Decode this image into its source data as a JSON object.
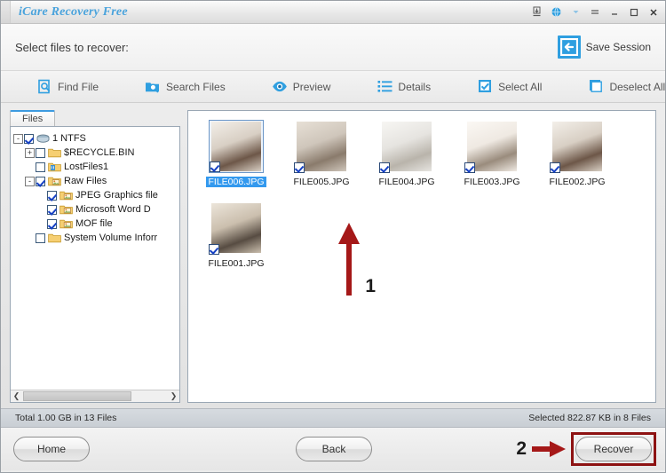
{
  "window": {
    "title": "iCare Recovery Free",
    "controls": [
      {
        "name": "save-download-icon",
        "glyph": "download"
      },
      {
        "name": "globe-icon",
        "glyph": "globe"
      },
      {
        "name": "dropdown-caret-icon",
        "glyph": "caret"
      },
      {
        "name": "menu-icon",
        "glyph": "menu"
      },
      {
        "name": "minimize-button",
        "glyph": "minimize"
      },
      {
        "name": "maximize-button",
        "glyph": "maximize"
      },
      {
        "name": "close-button",
        "glyph": "close"
      }
    ]
  },
  "header": {
    "title": "Select files to recover:",
    "save_session_label": "Save Session"
  },
  "toolbar": {
    "items": [
      {
        "label": "Find File",
        "icon": "find-file-icon"
      },
      {
        "label": "Search Files",
        "icon": "search-files-icon"
      },
      {
        "label": "Preview",
        "icon": "preview-eye-icon"
      },
      {
        "label": "Details",
        "icon": "details-list-icon"
      },
      {
        "label": "Select All",
        "icon": "select-all-checkbox-icon"
      },
      {
        "label": "Deselect All",
        "icon": "deselect-all-checkbox-icon"
      }
    ]
  },
  "tree": {
    "tab_label": "Files",
    "nodes": [
      {
        "label": "1 NTFS",
        "depth": 0,
        "checked": true,
        "expander": "-",
        "icon": "drive"
      },
      {
        "label": "$RECYCLE.BIN",
        "depth": 1,
        "checked": false,
        "expander": "+",
        "icon": "folder"
      },
      {
        "label": "LostFiles1",
        "depth": 1,
        "checked": false,
        "expander": "",
        "icon": "lostfolder"
      },
      {
        "label": "Raw Files",
        "depth": 1,
        "checked": true,
        "expander": "-",
        "icon": "rawfolder"
      },
      {
        "label": "JPEG Graphics file",
        "depth": 2,
        "checked": true,
        "expander": "",
        "icon": "rawfolder"
      },
      {
        "label": "Microsoft Word D",
        "depth": 2,
        "checked": true,
        "expander": "",
        "icon": "rawfolder"
      },
      {
        "label": "MOF file",
        "depth": 2,
        "checked": true,
        "expander": "",
        "icon": "rawfolder"
      },
      {
        "label": "System Volume Inforr",
        "depth": 1,
        "checked": false,
        "expander": "",
        "icon": "folder"
      }
    ]
  },
  "files": [
    {
      "name": "FILE006.JPG",
      "checked": true,
      "selected": true,
      "palette": [
        "#d8cfc4",
        "#6d5748",
        "#f3efe9"
      ]
    },
    {
      "name": "FILE005.JPG",
      "checked": true,
      "selected": false,
      "palette": [
        "#cfc6bb",
        "#8a7b6c",
        "#e7e0d6"
      ]
    },
    {
      "name": "FILE004.JPG",
      "checked": true,
      "selected": false,
      "palette": [
        "#e6e4e0",
        "#b9b4ab",
        "#f7f6f3"
      ]
    },
    {
      "name": "FILE003.JPG",
      "checked": true,
      "selected": false,
      "palette": [
        "#efe9e2",
        "#9a8c7d",
        "#fbf8f4"
      ]
    },
    {
      "name": "FILE002.JPG",
      "checked": true,
      "selected": false,
      "palette": [
        "#d8cfc4",
        "#6d5748",
        "#f3efe9"
      ]
    },
    {
      "name": "FILE001.JPG",
      "checked": true,
      "selected": false,
      "palette": [
        "#cbbfae",
        "#574c42",
        "#ece5da"
      ]
    }
  ],
  "status": {
    "total": "Total 1.00 GB in 13 Files",
    "selected": "Selected 822.87 KB in 8 Files"
  },
  "footer": {
    "home_label": "Home",
    "back_label": "Back",
    "recover_label": "Recover"
  },
  "annotations": {
    "step1": "1",
    "step2": "2",
    "color": "#a51818"
  }
}
